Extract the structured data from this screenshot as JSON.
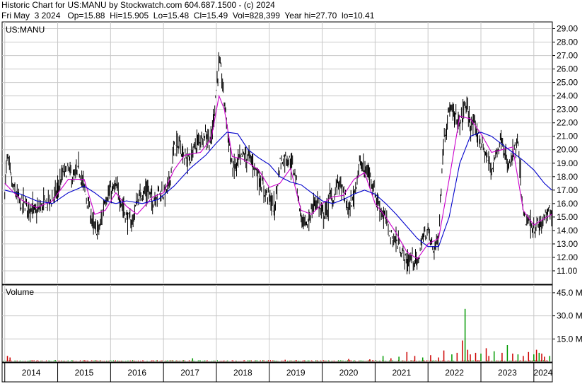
{
  "header": {
    "line1": "Historic Chart for US:MANU by Stockwatch.com 604.687.1500 - (c) 2024",
    "line2": "Fri May  3 2024   Op=15.88  Hi=15.905  Lo=15.48  Cl=15.49  Vol=828,399  Year hi=27.70  lo=10.41"
  },
  "price_panel": {
    "label": "US:MANU"
  },
  "volume_panel": {
    "label": "Volume"
  },
  "colors": {
    "price_bar": "#000000",
    "ma_short": "#cc00cc",
    "ma_long": "#0000cc",
    "volume_up": "#009900",
    "volume_down": "#cc0000",
    "grid": "#c8c8c8"
  },
  "chart_data": [
    {
      "type": "line",
      "panel": "price",
      "ylim": [
        10,
        29.5
      ],
      "y_ticks": [
        "11.00",
        "12.00",
        "13.00",
        "14.00",
        "15.00",
        "16.00",
        "17.00",
        "18.00",
        "19.00",
        "20.00",
        "21.00",
        "22.00",
        "23.00",
        "24.00",
        "25.00",
        "26.00",
        "27.00",
        "28.00",
        "29.00"
      ],
      "x_ticks": [
        "2014",
        "2015",
        "2016",
        "2017",
        "2018",
        "2019",
        "2020",
        "2021",
        "2022",
        "2023",
        "2024"
      ],
      "x_range": [
        2013.95,
        2024.35
      ],
      "series": [
        {
          "kind": "price",
          "x": [
            2014.0,
            2014.05,
            2014.15,
            2014.3,
            2014.45,
            2014.6,
            2014.75,
            2014.9,
            2015.0,
            2015.1,
            2015.2,
            2015.3,
            2015.4,
            2015.5,
            2015.6,
            2015.7,
            2015.8,
            2015.9,
            2016.0,
            2016.1,
            2016.2,
            2016.3,
            2016.4,
            2016.5,
            2016.6,
            2016.7,
            2016.8,
            2016.9,
            2017.0,
            2017.1,
            2017.2,
            2017.3,
            2017.4,
            2017.5,
            2017.6,
            2017.7,
            2017.8,
            2017.9,
            2018.0,
            2018.05,
            2018.1,
            2018.15,
            2018.2,
            2018.3,
            2018.4,
            2018.5,
            2018.6,
            2018.7,
            2018.8,
            2018.9,
            2019.0,
            2019.1,
            2019.2,
            2019.3,
            2019.4,
            2019.5,
            2019.6,
            2019.7,
            2019.8,
            2019.9,
            2020.0,
            2020.1,
            2020.15,
            2020.2,
            2020.3,
            2020.4,
            2020.5,
            2020.6,
            2020.7,
            2020.8,
            2020.9,
            2021.0,
            2021.1,
            2021.2,
            2021.3,
            2021.4,
            2021.5,
            2021.6,
            2021.7,
            2021.8,
            2021.9,
            2022.0,
            2022.1,
            2022.2,
            2022.3,
            2022.4,
            2022.5,
            2022.6,
            2022.7,
            2022.8,
            2022.9,
            2023.0,
            2023.1,
            2023.2,
            2023.3,
            2023.4,
            2023.5,
            2023.6,
            2023.7,
            2023.8,
            2023.9,
            2024.0,
            2024.1,
            2024.2,
            2024.3,
            2024.34
          ],
          "values": [
            17.0,
            19.5,
            17.2,
            16.0,
            15.8,
            15.3,
            16.0,
            16.3,
            17.0,
            18.2,
            18.5,
            17.8,
            18.5,
            17.2,
            15.5,
            14.0,
            14.2,
            16.5,
            16.8,
            17.2,
            16.2,
            15.0,
            14.5,
            16.2,
            16.8,
            17.0,
            16.2,
            16.9,
            16.7,
            17.3,
            20.0,
            20.5,
            19.5,
            19.2,
            20.3,
            20.8,
            21.3,
            20.5,
            24.5,
            26.5,
            25.5,
            23.5,
            22.0,
            18.5,
            19.0,
            19.6,
            19.5,
            19.0,
            18.0,
            17.0,
            16.5,
            15.5,
            19.0,
            19.5,
            19.2,
            18.0,
            15.0,
            14.2,
            15.5,
            16.3,
            15.2,
            15.5,
            16.8,
            16.0,
            17.8,
            16.8,
            15.5,
            16.5,
            19.0,
            18.5,
            18.2,
            16.8,
            15.6,
            14.8,
            13.5,
            13.2,
            12.5,
            11.6,
            12.0,
            11.5,
            13.5,
            14.0,
            12.5,
            13.5,
            21.0,
            23.0,
            22.5,
            21.8,
            23.5,
            22.0,
            21.5,
            20.5,
            19.5,
            18.5,
            20.0,
            21.0,
            18.5,
            19.5,
            20.5,
            15.0,
            14.5,
            14.2,
            14.3,
            14.8,
            15.5,
            15.49
          ]
        },
        {
          "name": "",
          "kind": "ma_short",
          "x": [
            2014.0,
            2014.3,
            2014.6,
            2014.9,
            2015.2,
            2015.5,
            2015.7,
            2015.9,
            2016.1,
            2016.3,
            2016.5,
            2016.8,
            2017.0,
            2017.2,
            2017.4,
            2017.7,
            2017.9,
            2018.05,
            2018.15,
            2018.3,
            2018.5,
            2018.8,
            2019.0,
            2019.2,
            2019.4,
            2019.6,
            2019.8,
            2020.0,
            2020.2,
            2020.4,
            2020.6,
            2020.8,
            2021.0,
            2021.2,
            2021.4,
            2021.6,
            2021.8,
            2022.0,
            2022.2,
            2022.4,
            2022.6,
            2022.8,
            2023.0,
            2023.2,
            2023.4,
            2023.6,
            2023.8,
            2024.0,
            2024.2,
            2024.34
          ],
          "values": [
            17.5,
            16.3,
            15.7,
            16.2,
            17.8,
            17.8,
            15.2,
            15.5,
            16.8,
            15.8,
            15.2,
            16.5,
            16.8,
            18.5,
            19.6,
            19.8,
            20.8,
            24.0,
            23.0,
            19.5,
            19.3,
            18.5,
            17.2,
            17.5,
            18.6,
            15.5,
            15.2,
            16.0,
            16.5,
            16.6,
            17.8,
            18.3,
            16.0,
            15.0,
            13.8,
            12.4,
            11.9,
            13.0,
            13.4,
            17.8,
            22.5,
            22.3,
            21.2,
            19.8,
            20.0,
            20.2,
            15.5,
            14.4,
            14.9,
            15.2
          ]
        },
        {
          "name": "",
          "kind": "ma_long",
          "x": [
            2014.0,
            2014.3,
            2014.6,
            2014.9,
            2015.2,
            2015.5,
            2015.7,
            2015.9,
            2016.1,
            2016.3,
            2016.6,
            2016.9,
            2017.2,
            2017.5,
            2017.8,
            2018.0,
            2018.2,
            2018.4,
            2018.6,
            2018.8,
            2019.0,
            2019.2,
            2019.4,
            2019.6,
            2019.8,
            2020.0,
            2020.2,
            2020.4,
            2020.6,
            2020.8,
            2021.0,
            2021.2,
            2021.4,
            2021.6,
            2021.8,
            2022.0,
            2022.2,
            2022.4,
            2022.6,
            2022.8,
            2023.0,
            2023.2,
            2023.4,
            2023.6,
            2023.8,
            2024.0,
            2024.2,
            2024.34
          ],
          "values": [
            17.0,
            16.7,
            16.2,
            16.0,
            16.8,
            17.3,
            16.8,
            16.2,
            16.0,
            16.2,
            16.0,
            16.3,
            17.3,
            18.6,
            19.6,
            20.5,
            21.3,
            21.2,
            20.0,
            19.4,
            18.9,
            18.0,
            17.6,
            17.4,
            16.8,
            16.2,
            16.0,
            16.3,
            16.7,
            17.0,
            16.7,
            16.0,
            15.2,
            14.3,
            13.4,
            12.8,
            12.8,
            15.0,
            19.0,
            21.0,
            21.3,
            21.0,
            20.4,
            19.8,
            19.2,
            18.5,
            17.5,
            17.0
          ]
        }
      ]
    },
    {
      "type": "bar",
      "panel": "volume",
      "ylim": [
        0,
        50
      ],
      "y_unit": "M",
      "y_ticks": [
        "15.0 M",
        "30.0 M",
        "45.0 M"
      ],
      "x": [
        2014.05,
        2014.1,
        2015.5,
        2017.55,
        2019.3,
        2020.5,
        2020.9,
        2021.15,
        2021.3,
        2021.45,
        2021.6,
        2021.75,
        2021.9,
        2022.05,
        2022.2,
        2022.3,
        2022.45,
        2022.55,
        2022.65,
        2022.7,
        2022.75,
        2022.8,
        2022.9,
        2023.0,
        2023.1,
        2023.15,
        2023.25,
        2023.4,
        2023.5,
        2023.6,
        2023.7,
        2023.8,
        2023.9,
        2024.0,
        2024.05,
        2024.1,
        2024.15,
        2024.2,
        2024.3
      ],
      "values": [
        4.0,
        3.0,
        1.2,
        2.5,
        1.5,
        2.0,
        1.8,
        4.0,
        2.5,
        3.5,
        6.5,
        4.0,
        3.0,
        4.5,
        3.0,
        7.5,
        5.0,
        6.0,
        14.0,
        34.5,
        8.0,
        5.0,
        6.0,
        5.5,
        9.0,
        4.0,
        7.0,
        6.0,
        11.0,
        5.5,
        5.0,
        4.0,
        6.5,
        5.0,
        8.0,
        6.0,
        5.5,
        3.5,
        4.0
      ],
      "up": [
        false,
        false,
        false,
        true,
        false,
        false,
        false,
        true,
        false,
        true,
        false,
        false,
        true,
        false,
        false,
        false,
        true,
        false,
        false,
        true,
        false,
        false,
        false,
        true,
        false,
        false,
        true,
        false,
        true,
        false,
        true,
        false,
        false,
        true,
        false,
        true,
        false,
        false,
        true
      ]
    }
  ]
}
